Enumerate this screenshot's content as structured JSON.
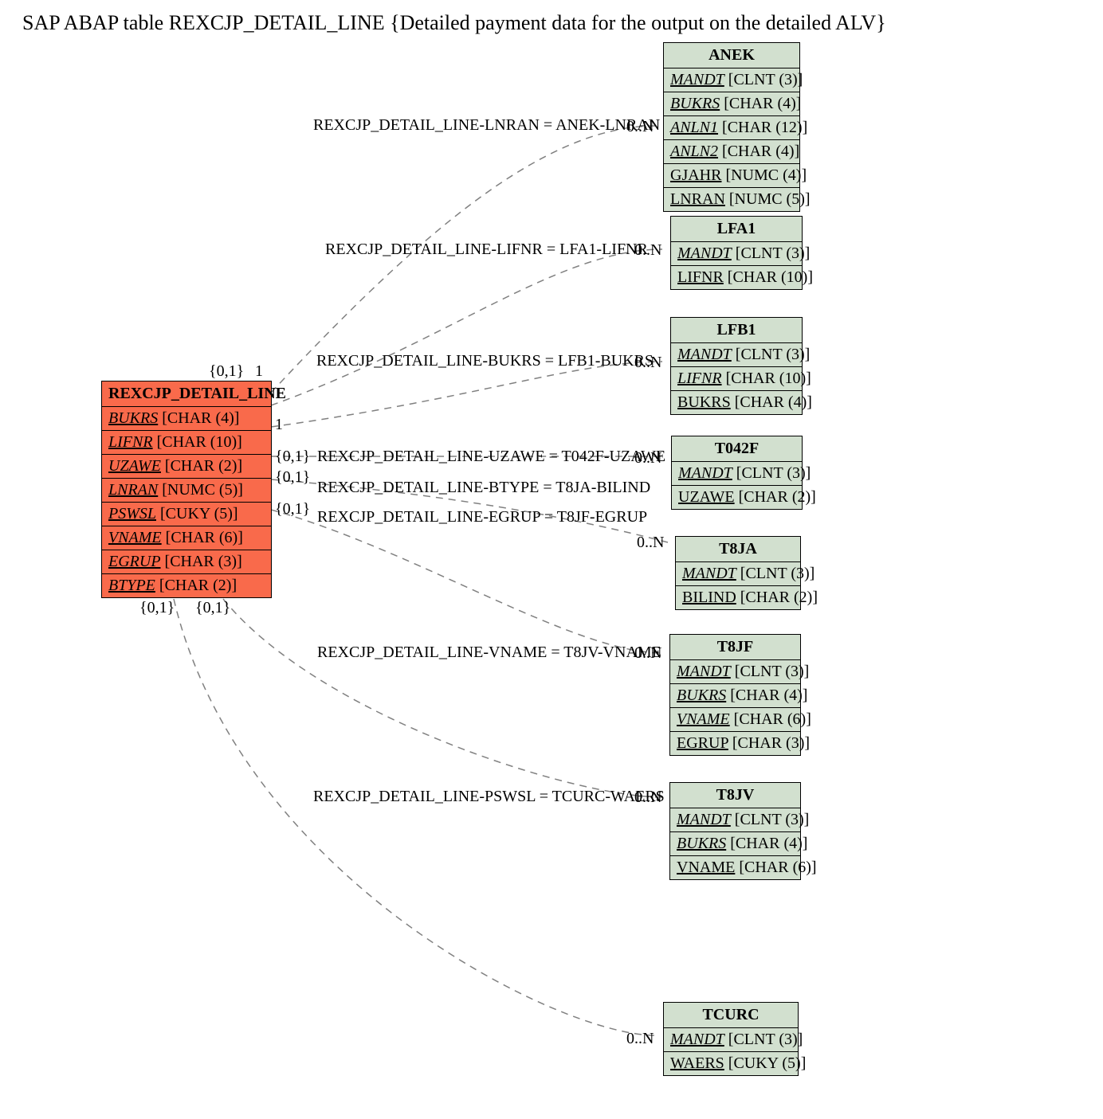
{
  "title_prefix": "SAP ABAP table ",
  "title_table": "REXCJP_DETAIL_LINE",
  "title_suffix": " {Detailed payment data for the output on the detailed ALV}",
  "main": {
    "name": "REXCJP_DETAIL_LINE",
    "fields": [
      {
        "name": "BUKRS",
        "type": "[CHAR (4)]"
      },
      {
        "name": "LIFNR",
        "type": "[CHAR (10)]"
      },
      {
        "name": "UZAWE",
        "type": "[CHAR (2)]"
      },
      {
        "name": "LNRAN",
        "type": "[NUMC (5)]"
      },
      {
        "name": "PSWSL",
        "type": "[CUKY (5)]"
      },
      {
        "name": "VNAME",
        "type": "[CHAR (6)]"
      },
      {
        "name": "EGRUP",
        "type": "[CHAR (3)]"
      },
      {
        "name": "BTYPE",
        "type": "[CHAR (2)]"
      }
    ]
  },
  "targets": [
    {
      "name": "ANEK",
      "fields": [
        {
          "name": "MANDT",
          "type": "[CLNT (3)]",
          "fk": true
        },
        {
          "name": "BUKRS",
          "type": "[CHAR (4)]",
          "fk": true
        },
        {
          "name": "ANLN1",
          "type": "[CHAR (12)]",
          "fk": true
        },
        {
          "name": "ANLN2",
          "type": "[CHAR (4)]",
          "fk": true
        },
        {
          "name": "GJAHR",
          "type": "[NUMC (4)]",
          "pk": true
        },
        {
          "name": "LNRAN",
          "type": "[NUMC (5)]",
          "pk": true
        }
      ]
    },
    {
      "name": "LFA1",
      "fields": [
        {
          "name": "MANDT",
          "type": "[CLNT (3)]",
          "fk": true
        },
        {
          "name": "LIFNR",
          "type": "[CHAR (10)]",
          "pk": true
        }
      ]
    },
    {
      "name": "LFB1",
      "fields": [
        {
          "name": "MANDT",
          "type": "[CLNT (3)]",
          "fk": true
        },
        {
          "name": "LIFNR",
          "type": "[CHAR (10)]",
          "fk": true
        },
        {
          "name": "BUKRS",
          "type": "[CHAR (4)]",
          "pk": true
        }
      ]
    },
    {
      "name": "T042F",
      "fields": [
        {
          "name": "MANDT",
          "type": "[CLNT (3)]",
          "fk": true
        },
        {
          "name": "UZAWE",
          "type": "[CHAR (2)]",
          "pk": true
        }
      ]
    },
    {
      "name": "T8JA",
      "fields": [
        {
          "name": "MANDT",
          "type": "[CLNT (3)]",
          "fk": true
        },
        {
          "name": "BILIND",
          "type": "[CHAR (2)]",
          "pk": true
        }
      ]
    },
    {
      "name": "T8JF",
      "fields": [
        {
          "name": "MANDT",
          "type": "[CLNT (3)]",
          "fk": true
        },
        {
          "name": "BUKRS",
          "type": "[CHAR (4)]",
          "fk": true
        },
        {
          "name": "VNAME",
          "type": "[CHAR (6)]",
          "fk": true
        },
        {
          "name": "EGRUP",
          "type": "[CHAR (3)]",
          "pk": true
        }
      ]
    },
    {
      "name": "T8JV",
      "fields": [
        {
          "name": "MANDT",
          "type": "[CLNT (3)]",
          "fk": true
        },
        {
          "name": "BUKRS",
          "type": "[CHAR (4)]",
          "fk": true
        },
        {
          "name": "VNAME",
          "type": "[CHAR (6)]",
          "pk": true
        }
      ]
    },
    {
      "name": "TCURC",
      "fields": [
        {
          "name": "MANDT",
          "type": "[CLNT (3)]",
          "fk": true
        },
        {
          "name": "WAERS",
          "type": "[CUKY (5)]",
          "pk": true
        }
      ]
    }
  ],
  "relations": [
    {
      "label": "REXCJP_DETAIL_LINE-LNRAN = ANEK-LNRAN"
    },
    {
      "label": "REXCJP_DETAIL_LINE-LIFNR = LFA1-LIFNR"
    },
    {
      "label": "REXCJP_DETAIL_LINE-BUKRS = LFB1-BUKRS"
    },
    {
      "label": "REXCJP_DETAIL_LINE-UZAWE = T042F-UZAWE"
    },
    {
      "label": "REXCJP_DETAIL_LINE-BTYPE = T8JA-BILIND"
    },
    {
      "label": "REXCJP_DETAIL_LINE-EGRUP = T8JF-EGRUP"
    },
    {
      "label": "REXCJP_DETAIL_LINE-VNAME = T8JV-VNAME"
    },
    {
      "label": "REXCJP_DETAIL_LINE-PSWSL = TCURC-WAERS"
    }
  ],
  "cards": {
    "src_top": "{0,1}",
    "src_top_r": "1",
    "src_mid1": "1",
    "src_mid2": "{0,1}",
    "src_mid3": "{0,1}",
    "src_mid4": "{0,1}",
    "src_bot_l": "{0,1}",
    "src_bot_r": "{0,1}",
    "tgt": "0..N"
  }
}
